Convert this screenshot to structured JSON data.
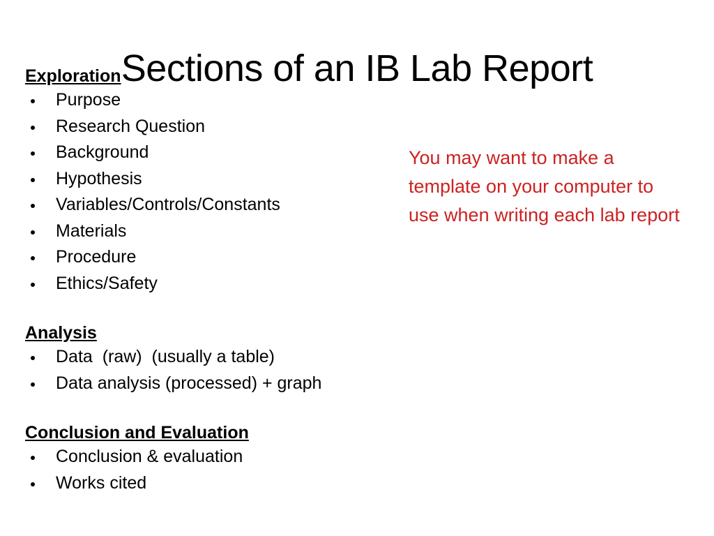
{
  "slide": {
    "title": "Sections of an IB Lab Report",
    "background_color": "#FFFFFF",
    "text_color": "#000000",
    "accent_color": "#CC2222"
  },
  "sections": [
    {
      "heading": "Exploration",
      "items": [
        "Purpose",
        "Research Question",
        "Background",
        "Hypothesis",
        "Variables/Controls/Constants",
        "Materials",
        "Procedure",
        "Ethics/Safety"
      ]
    },
    {
      "heading": "Analysis",
      "items": [
        "Data  (raw)  (usually a table)",
        "Data analysis (processed) + graph"
      ]
    },
    {
      "heading": "Conclusion and Evaluation",
      "items": [
        "Conclusion & evaluation",
        "Works cited"
      ]
    }
  ],
  "note": {
    "text": "You may want to make a template on your computer to use when writing each lab report",
    "color": "#CC2222"
  }
}
